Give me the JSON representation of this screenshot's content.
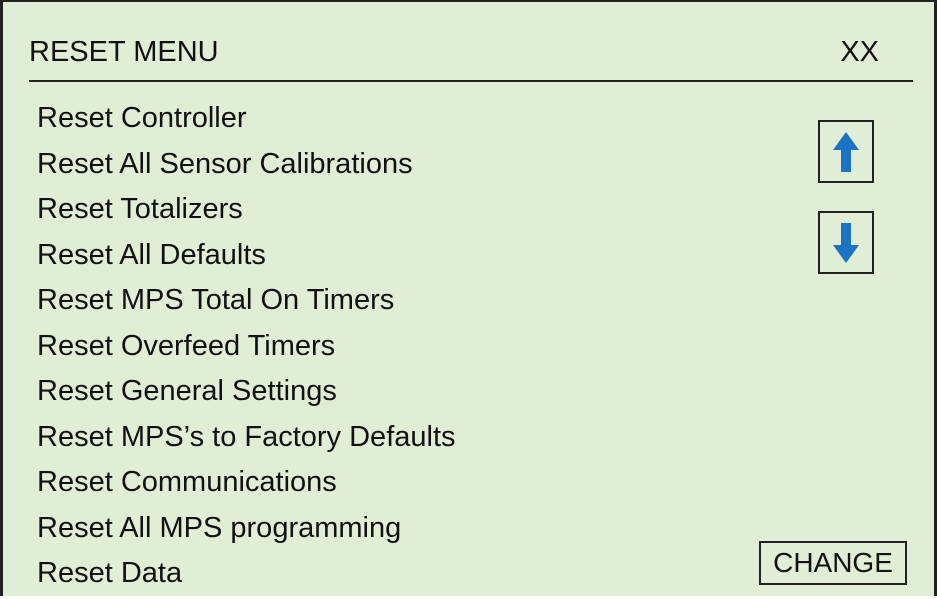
{
  "header": {
    "title": "RESET MENU",
    "code": "XX"
  },
  "menu": {
    "items": [
      "Reset Controller",
      "Reset All Sensor Calibrations",
      "Reset Totalizers",
      "Reset All Defaults",
      "Reset MPS Total On Timers",
      "Reset Overfeed Timers",
      "Reset General Settings",
      "Reset MPS’s to Factory Defaults",
      "Reset Communications",
      "Reset All MPS programming",
      "Reset Data"
    ]
  },
  "buttons": {
    "scroll_up_icon": "arrow-up-icon",
    "scroll_down_icon": "arrow-down-icon",
    "change_label": "CHANGE"
  },
  "colors": {
    "screen_background": "#e0eed6",
    "arrow": "#1a73c4",
    "text": "#111111",
    "border": "#222222"
  }
}
